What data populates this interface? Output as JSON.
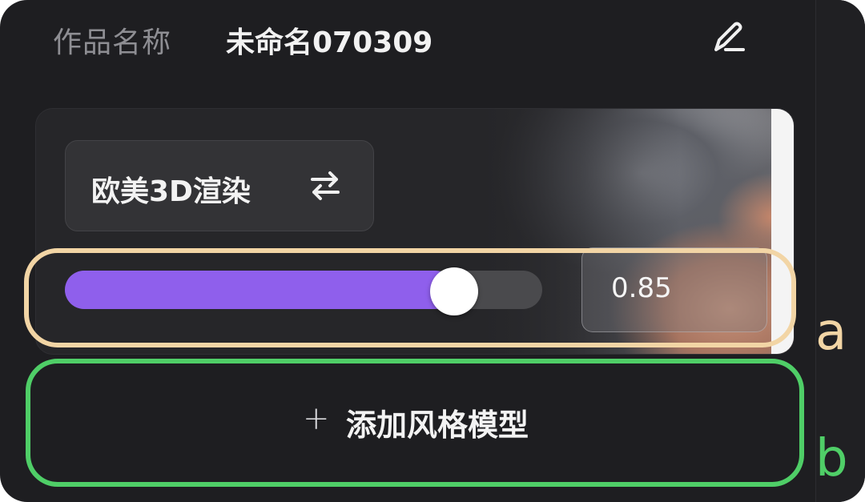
{
  "header": {
    "label": "作品名称",
    "value": "未命名070309",
    "edit_icon": "pencil-icon"
  },
  "style_card": {
    "style_name": "欧美3D渲染",
    "switch_icon": "swap-arrows-icon"
  },
  "slider": {
    "value": 0.85,
    "value_text": "0.85",
    "fill_color": "#8f5fec"
  },
  "add_button": {
    "plus": "+",
    "label": "添加风格模型"
  },
  "annotations": {
    "a": "a",
    "b": "b"
  }
}
